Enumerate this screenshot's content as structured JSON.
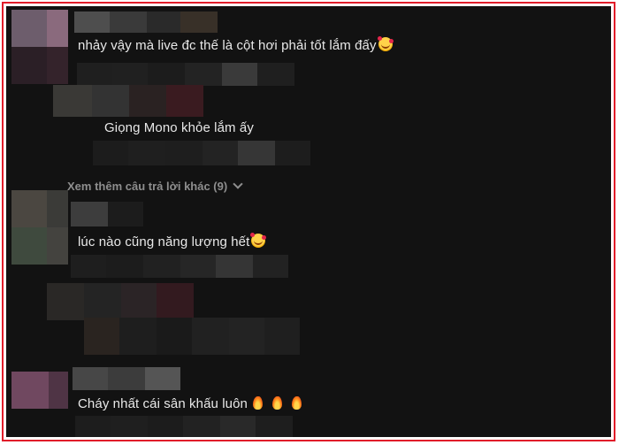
{
  "colors": {
    "border": "#e11d2a",
    "background": "#121212",
    "text": "#e8e8e8",
    "muted": "#8e8e8e"
  },
  "comments": [
    {
      "text": "nhảy vậy mà live đc thế là cột hơi phải tốt lắm đấy",
      "emoji": "smiling-face-with-hearts-icon"
    },
    {
      "text": "Giọng Mono khỏe lắm ấy"
    },
    {
      "text": "lúc nào cũng năng lượng hết",
      "emoji": "smiling-face-with-hearts-icon"
    },
    {
      "text": "Cháy nhất cái sân khấu luôn",
      "emoji": "fire-icon"
    }
  ],
  "more_replies": {
    "label": "Xem thêm câu trả lời khác (9)"
  }
}
